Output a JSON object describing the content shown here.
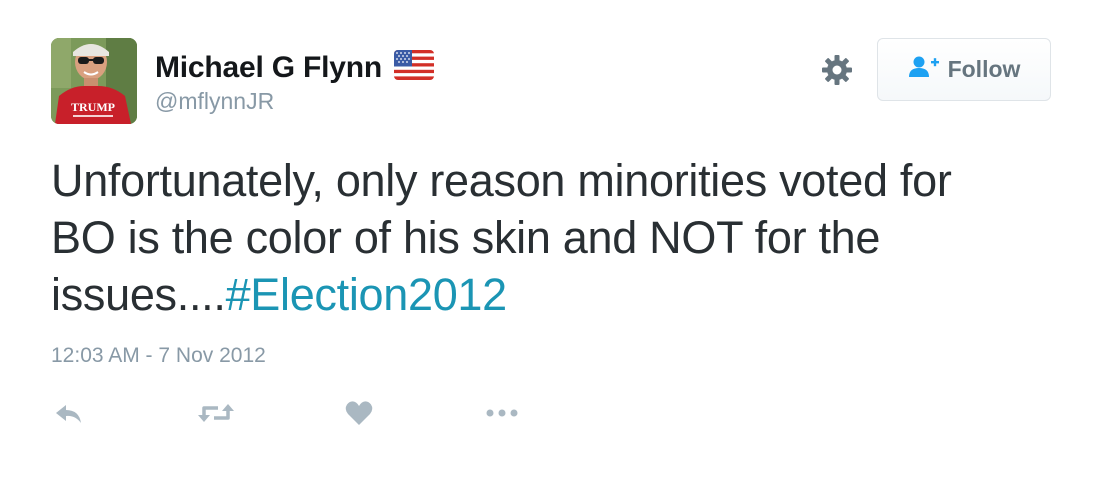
{
  "user": {
    "display_name": "Michael G Flynn",
    "handle": "@mflynnJR",
    "avatar_shirt_text": "TRUMP",
    "flag_icon": "us-flag-icon"
  },
  "follow_button": {
    "label": "Follow",
    "icon": "person-add-icon"
  },
  "settings_icon": "gear-icon",
  "tweet": {
    "text_line1": "Unfortunately, only reason minorities voted for",
    "text_line2": "BO is the color of his skin and NOT for the",
    "text_line3_plain": "issues....",
    "hashtag": "#Election2012",
    "timestamp": "12:03 AM - 7 Nov 2012"
  },
  "actions": [
    "reply-icon",
    "retweet-icon",
    "like-icon",
    "more-icon"
  ],
  "colors": {
    "name": "#14171a",
    "secondary": "#8899a6",
    "body_text": "#292f33",
    "hashtag": "#1b95b4",
    "icon_gray": "#aab8c2",
    "follow_icon_blue": "#1da1f2"
  }
}
